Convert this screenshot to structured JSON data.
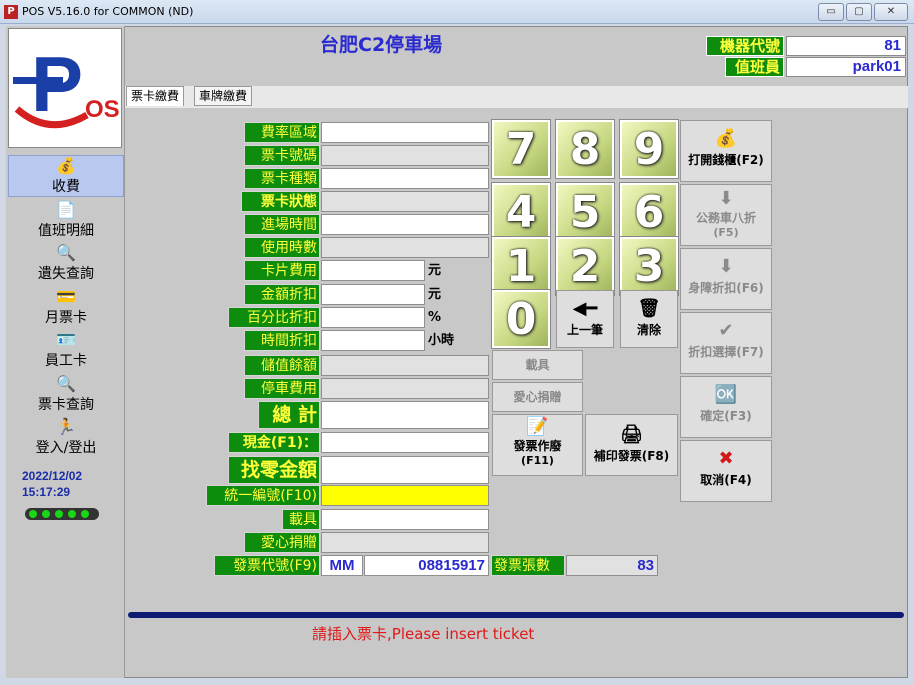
{
  "window": {
    "title": "POS V5.16.0 for COMMON (ND)",
    "app_icon": "P",
    "min": "▭",
    "max": "▢",
    "close": "✕"
  },
  "logo": {
    "text": "P",
    "sub": "OS"
  },
  "nav": [
    {
      "label": "收費",
      "icon": "coins-icon",
      "glyph": "💰"
    },
    {
      "label": "值班明細",
      "icon": "document-icon",
      "glyph": "📄"
    },
    {
      "label": "遺失查詢",
      "icon": "magnifier-icon",
      "glyph": "🔍"
    },
    {
      "label": "月票卡",
      "icon": "card-icon",
      "glyph": "💳"
    },
    {
      "label": "員工卡",
      "icon": "id-card-icon",
      "glyph": "🪪"
    },
    {
      "label": "票卡查詢",
      "icon": "magnifier-icon",
      "glyph": "🔍"
    },
    {
      "label": "登入/登出",
      "icon": "person-icon",
      "glyph": "🏃"
    }
  ],
  "datetime": {
    "date": "2022/12/02",
    "time": "15:17:29"
  },
  "header": {
    "lot_name": "台肥C2停車場",
    "machine_label": "機器代號",
    "machine_value": "81",
    "staff_label": "值班員",
    "staff_value": "park01"
  },
  "tabs": [
    "票卡繳費",
    "車牌繳費"
  ],
  "form": {
    "rate_area": "費率區域",
    "card_no": "票卡號碼",
    "card_type": "票卡種類",
    "card_status": "票卡狀態",
    "entry_time": "進場時間",
    "duration": "使用時數",
    "card_fee": "卡片費用",
    "amount_discount": "金額折扣",
    "percent_discount": "百分比折扣",
    "time_discount": "時間折扣",
    "stored_balance": "儲值餘額",
    "parking_fee": "停車費用",
    "total": "總 計",
    "cash": "現金(F1)：",
    "change": "找零金額",
    "tax_id": "統一編號(F10)",
    "carrier": "載具",
    "donation": "愛心捐贈",
    "invoice_code": "發票代號(F9)",
    "invoice_prefix": "MM",
    "invoice_no": "08815917",
    "invoice_count_label": "發票張數",
    "invoice_count": "83"
  },
  "units": {
    "yuan": "元",
    "yuan2": "元",
    "percent": "%",
    "hours": "小時"
  },
  "keypad": {
    "k7": "7",
    "k8": "8",
    "k9": "9",
    "k4": "4",
    "k5": "5",
    "k6": "6",
    "k1": "1",
    "k2": "2",
    "k3": "3",
    "k0": "0"
  },
  "buttons": {
    "back": "上一筆",
    "clear": "清除",
    "carrier": "載具",
    "donation": "愛心捐贈",
    "void_invoice": "發票作廢",
    "void_invoice_key": "(F11)",
    "reprint": "補印發票(F8)",
    "open_drawer": "打開錢櫃(F2)",
    "official_car": "公務車八折",
    "official_car_key": "(F5)",
    "disabled_discount": "身障折扣(F6)",
    "discount_select": "折扣選擇(F7)",
    "confirm": "確定(F3)",
    "cancel": "取消(F4)"
  },
  "status": {
    "message": "請插入票卡,Please insert ticket"
  }
}
